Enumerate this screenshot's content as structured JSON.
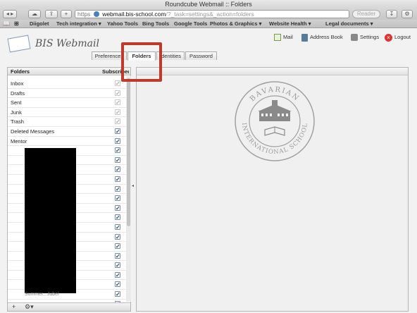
{
  "window": {
    "title": "Roundcube Webmail :: Folders"
  },
  "browser": {
    "url_https": "https",
    "url_host": "webmail.bis-school.com",
    "url_path": "/?_task=settings&_action=folders",
    "reader_label": "Reader",
    "bookmarks": [
      "Diigolet",
      "Tech integration ▾",
      "Yahoo Tools",
      "Bing Tools",
      "Google Tools",
      "Photos & Graphics ▾",
      "Website Health ▾",
      "Legal documents ▾"
    ]
  },
  "app": {
    "logo_text": "BIS Webmail",
    "nav": {
      "mail": "Mail",
      "address_book": "Address Book",
      "settings": "Settings",
      "logout": "Logout"
    },
    "tabs": [
      "Preferences",
      "Folders",
      "Identities",
      "Password"
    ],
    "active_tab": "Folders"
  },
  "folders": {
    "header_name": "Folders",
    "header_subscribed": "Subscribed",
    "items": [
      {
        "name": "Inbox",
        "subscribed": true,
        "locked": true
      },
      {
        "name": "Drafts",
        "subscribed": true,
        "locked": true
      },
      {
        "name": "Sent",
        "subscribed": true,
        "locked": true
      },
      {
        "name": "Junk",
        "subscribed": true,
        "locked": true
      },
      {
        "name": "Trash",
        "subscribed": true,
        "locked": true
      },
      {
        "name": "Deleted Messages",
        "subscribed": true,
        "locked": false
      },
      {
        "name": "Mentor",
        "subscribed": true,
        "locked": false
      }
    ],
    "partial_row": "Summer...Jubel",
    "footer": {
      "add": "+",
      "options": "⚙▾"
    }
  },
  "seal": {
    "top_text": "BAVARIAN",
    "bottom_text": "INTERNATIONAL SCHOOL"
  },
  "colors": {
    "highlight": "#c0392b",
    "check": "#1f3f8f"
  }
}
